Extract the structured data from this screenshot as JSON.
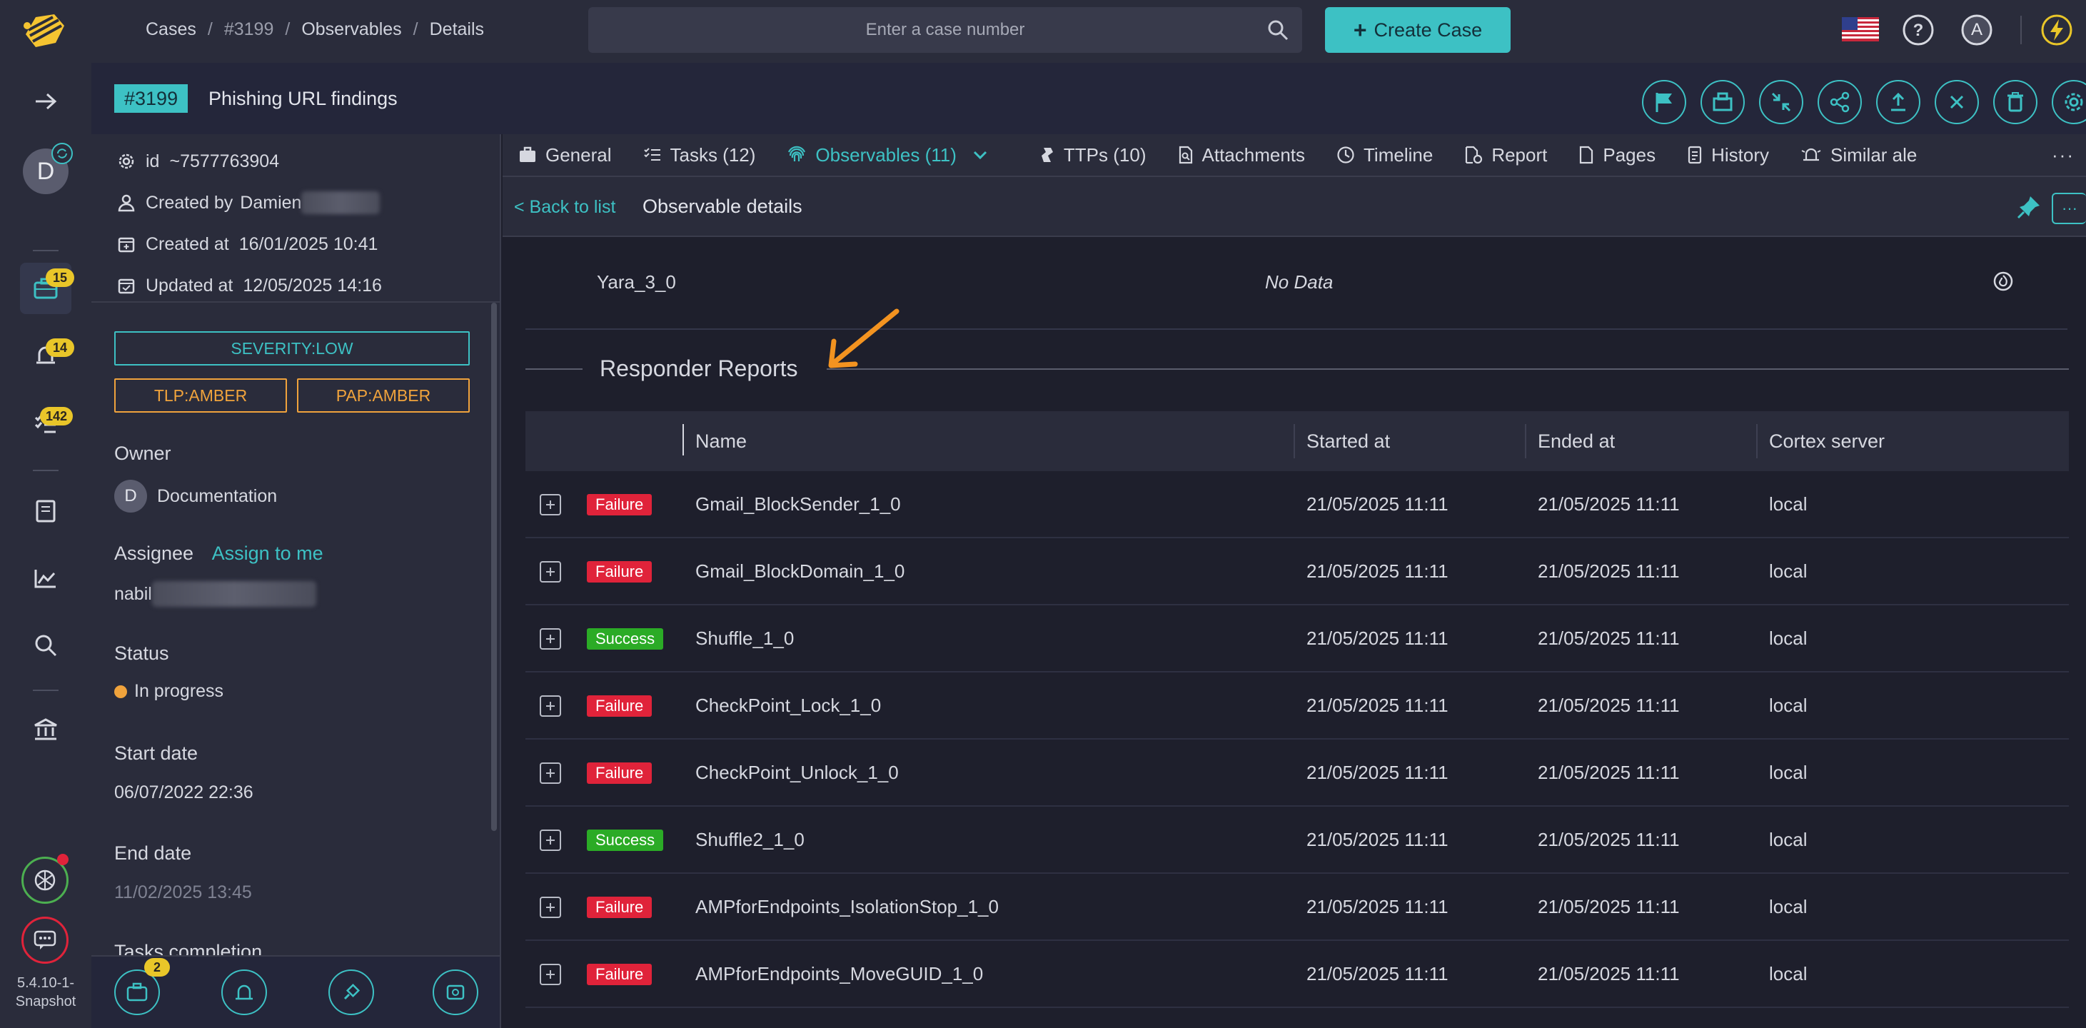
{
  "header": {
    "breadcrumbs": [
      "Cases",
      "#3199",
      "Observables",
      "Details"
    ],
    "search_placeholder": "Enter a case number",
    "create_label": "Create Case",
    "user_initial": "A"
  },
  "nav": {
    "user_initial": "D",
    "badges": {
      "cases": "15",
      "alerts": "14",
      "tasks": "142"
    },
    "version": "5.4.10-1-Snapshot"
  },
  "case": {
    "number": "#3199",
    "title": "Phishing URL findings",
    "id_label": "id",
    "id_value": "~7577763904",
    "created_by_label": "Created by",
    "created_by_value": "Damien",
    "created_at_label": "Created at",
    "created_at_value": "16/01/2025 10:41",
    "updated_at_label": "Updated at",
    "updated_at_value": "12/05/2025 14:16",
    "severity": "SEVERITY:LOW",
    "tlp": "TLP:AMBER",
    "pap": "PAP:AMBER",
    "owner_label": "Owner",
    "owner_initial": "D",
    "owner_value": "Documentation",
    "assignee_label": "Assignee",
    "assign_to_me": "Assign to me",
    "assignee_value": "nabil",
    "status_label": "Status",
    "status_value": "In progress",
    "start_label": "Start date",
    "start_value": "06/07/2022 22:36",
    "end_label": "End date",
    "end_value": "11/02/2025 13:45",
    "tasks_label": "Tasks completion",
    "footer_badge": "2"
  },
  "tabs": [
    {
      "label": "General"
    },
    {
      "label": "Tasks (12)"
    },
    {
      "label": "Observables (11)"
    },
    {
      "label": "TTPs (10)"
    },
    {
      "label": "Attachments"
    },
    {
      "label": "Timeline"
    },
    {
      "label": "Report"
    },
    {
      "label": "Pages"
    },
    {
      "label": "History"
    },
    {
      "label": "Similar ale"
    }
  ],
  "observable": {
    "back_label": "< Back to list",
    "title": "Observable details",
    "analyzer_name": "Yara_3_0",
    "analyzer_value": "No Data"
  },
  "responders": {
    "title": "Responder Reports",
    "columns": [
      "Name",
      "Started at",
      "Ended at",
      "Cortex server"
    ],
    "rows": [
      {
        "status": "Failure",
        "name": "Gmail_BlockSender_1_0",
        "started": "21/05/2025 11:11",
        "ended": "21/05/2025 11:11",
        "server": "local"
      },
      {
        "status": "Failure",
        "name": "Gmail_BlockDomain_1_0",
        "started": "21/05/2025 11:11",
        "ended": "21/05/2025 11:11",
        "server": "local"
      },
      {
        "status": "Success",
        "name": "Shuffle_1_0",
        "started": "21/05/2025 11:11",
        "ended": "21/05/2025 11:11",
        "server": "local"
      },
      {
        "status": "Failure",
        "name": "CheckPoint_Lock_1_0",
        "started": "21/05/2025 11:11",
        "ended": "21/05/2025 11:11",
        "server": "local"
      },
      {
        "status": "Failure",
        "name": "CheckPoint_Unlock_1_0",
        "started": "21/05/2025 11:11",
        "ended": "21/05/2025 11:11",
        "server": "local"
      },
      {
        "status": "Success",
        "name": "Shuffle2_1_0",
        "started": "21/05/2025 11:11",
        "ended": "21/05/2025 11:11",
        "server": "local"
      },
      {
        "status": "Failure",
        "name": "AMPforEndpoints_IsolationStop_1_0",
        "started": "21/05/2025 11:11",
        "ended": "21/05/2025 11:11",
        "server": "local"
      },
      {
        "status": "Failure",
        "name": "AMPforEndpoints_MoveGUID_1_0",
        "started": "21/05/2025 11:11",
        "ended": "21/05/2025 11:11",
        "server": "local"
      }
    ]
  },
  "colors": {
    "accent": "#3dc1c4",
    "amber": "#f0a33c",
    "failure": "#e0233a",
    "success": "#2bab26",
    "badge": "#e9c629"
  }
}
